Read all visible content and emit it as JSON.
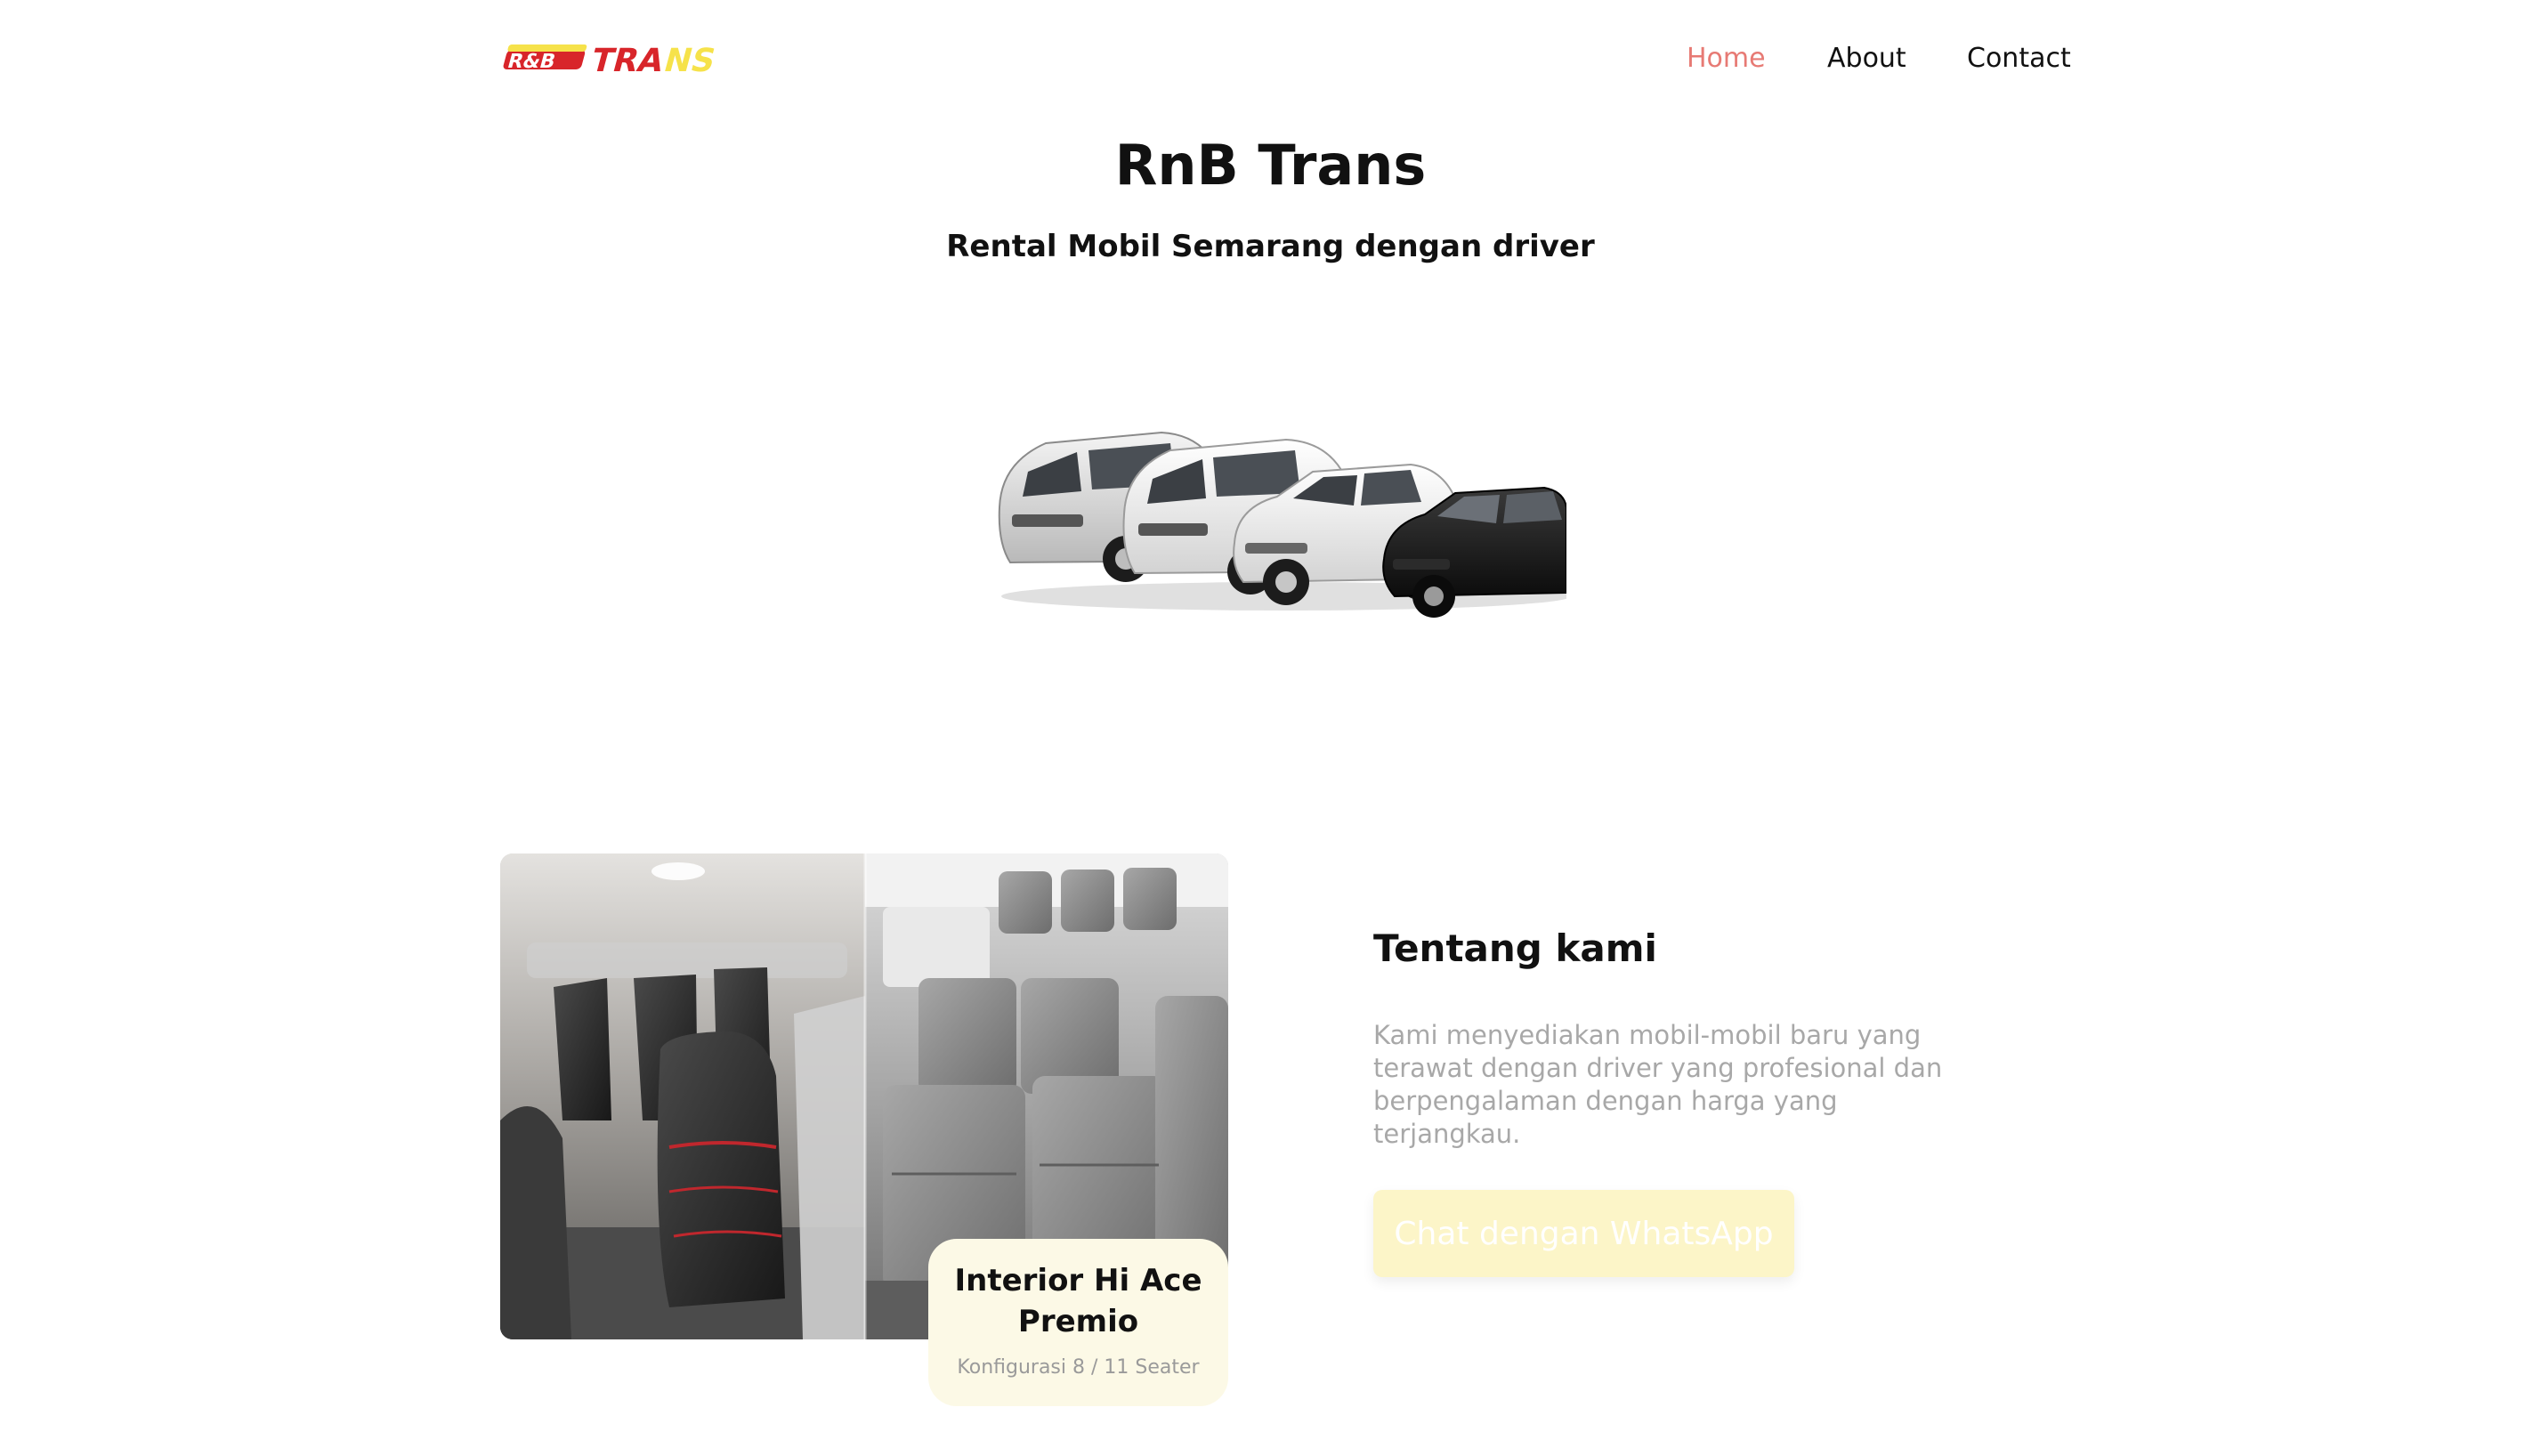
{
  "header": {
    "logo_text": "R&B TRANS",
    "nav": [
      {
        "label": "Home",
        "active": true
      },
      {
        "label": "About",
        "active": false
      },
      {
        "label": "Contact",
        "active": false
      }
    ]
  },
  "hero": {
    "title": "RnB Trans",
    "subtitle": "Rental Mobil Semarang dengan driver",
    "image_alt": "cars-lineup"
  },
  "about": {
    "title": "Tentang kami",
    "description": "Kami menyediakan mobil-mobil baru yang terawat dengan driver yang profesional dan berpengalaman dengan harga yang terjangkau.",
    "cta_label": "Chat dengan WhatsApp",
    "image_card": {
      "title": "Interior Hi Ace Premio",
      "subtitle": "Konfigurasi 8 / 11 Seater"
    }
  },
  "colors": {
    "accent_nav": "#e77a74",
    "logo_red": "#d8252a",
    "logo_yellow": "#f6e24a",
    "cta_bg": "#fcf5c8",
    "card_bg": "#fcf9e6"
  }
}
